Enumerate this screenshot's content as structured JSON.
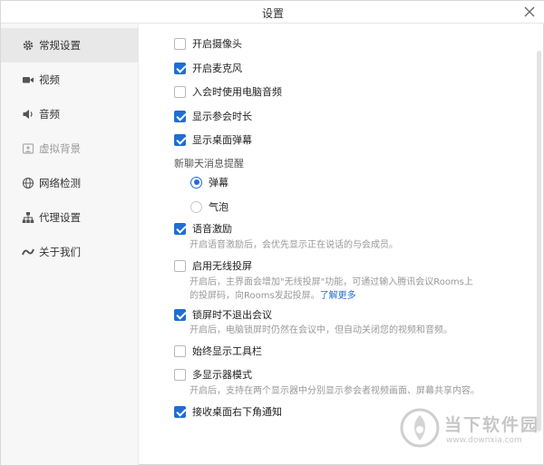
{
  "window": {
    "title": "设置"
  },
  "sidebar": {
    "items": [
      {
        "label": "常规设置",
        "icon": "gear-icon",
        "active": true
      },
      {
        "label": "视频",
        "icon": "camera-icon"
      },
      {
        "label": "音频",
        "icon": "speaker-icon"
      },
      {
        "label": "虚拟背景",
        "icon": "image-icon",
        "disabled": true
      },
      {
        "label": "网络检测",
        "icon": "globe-icon"
      },
      {
        "label": "代理设置",
        "icon": "network-icon"
      },
      {
        "label": "关于我们",
        "icon": "logo-icon"
      }
    ]
  },
  "settings": {
    "open_camera": {
      "label": "开启摄像头",
      "checked": false
    },
    "open_mic": {
      "label": "开启麦克风",
      "checked": true
    },
    "pc_audio": {
      "label": "入会时使用电脑音频",
      "checked": false
    },
    "show_duration": {
      "label": "显示参会时长",
      "checked": true
    },
    "desktop_barrage": {
      "label": "显示桌面弹幕",
      "checked": true
    },
    "chat_reminder": {
      "label": "新聊天消息提醒",
      "options": [
        {
          "label": "弹幕",
          "selected": true
        },
        {
          "label": "气泡",
          "selected": false
        }
      ]
    },
    "voice_motivation": {
      "label": "语音激励",
      "checked": true,
      "desc": "开启语音激励后，会优先显示正在说话的与会成员。"
    },
    "wireless_projection": {
      "label": "启用无线投屏",
      "checked": false,
      "desc_line1": "开启后，主界面会增加\"无线投屏\"功能，可通过输入腾讯会议Rooms上",
      "desc_line2": "的投屏码，向Rooms发起投屏。",
      "link": "了解更多"
    },
    "lock_no_exit": {
      "label": "锁屏时不退出会议",
      "checked": true,
      "desc": "开启后，电脑锁屏时仍然在会议中，但自动关闭您的视频和音频。"
    },
    "always_toolbar": {
      "label": "始终显示工具栏",
      "checked": false
    },
    "multi_display": {
      "label": "多显示器模式",
      "checked": false,
      "desc": "开启后，支持在两个显示器中分别显示参会者视频画面、屏幕共享内容。"
    },
    "bottom_right_notify": {
      "label": "接收桌面右下角通知",
      "checked": true
    }
  },
  "watermark": {
    "brand": "当下软件园",
    "url": "www.downxia.com"
  },
  "colors": {
    "accent": "#1f6ed4",
    "sidebar_bg": "#f7f7f7",
    "active_bg": "#e8e8e8"
  }
}
